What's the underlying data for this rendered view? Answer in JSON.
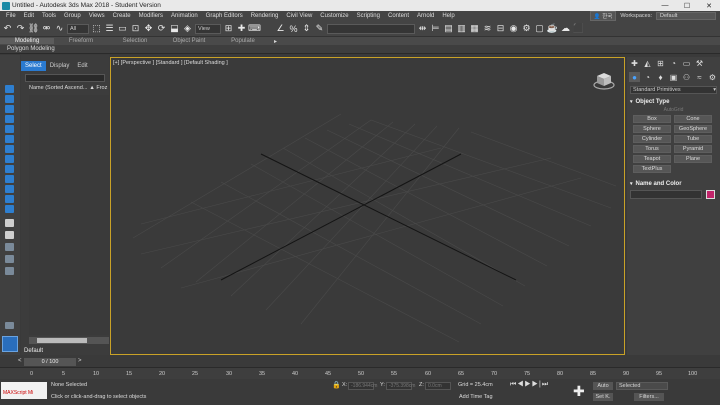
{
  "window": {
    "title": "Untitled - Autodesk 3ds Max 2018 - Student Version",
    "minimize": "—",
    "maximize": "☐",
    "close": "✕"
  },
  "menu": {
    "items": [
      "File",
      "Edit",
      "Tools",
      "Group",
      "Views",
      "Create",
      "Modifiers",
      "Animation",
      "Graph Editors",
      "Rendering",
      "Civil View",
      "Customize",
      "Scripting",
      "Content",
      "Arnold",
      "Help"
    ],
    "user": "👤 한국",
    "workspaces_label": "Workspaces:",
    "workspace": "Default"
  },
  "toolbar": {
    "selection_filter": "All",
    "ref_coord": "View"
  },
  "ribbon": {
    "tabs": [
      "Modeling",
      "Freeform",
      "Selection",
      "Object Paint",
      "Populate"
    ],
    "subtitle": "Polygon Modeling"
  },
  "scene_explorer": {
    "tabs": [
      "Select",
      "Display",
      "Edit"
    ],
    "column_name": "Name (Sorted Ascend...",
    "column_frozen": "▲ Froz"
  },
  "layer": {
    "name": "Default"
  },
  "viewport": {
    "label": "[+] [Perspective ] [Standard ] [Default Shading ]"
  },
  "command_panel": {
    "category": "Standard Primitives",
    "object_type_title": "Object Type",
    "autogrid": "AutoGrid",
    "primitives": [
      "Box",
      "Cone",
      "Sphere",
      "GeoSphere",
      "Cylinder",
      "Tube",
      "Torus",
      "Pyramid",
      "Teapot",
      "Plane",
      "TextPlus"
    ],
    "name_color_title": "Name and Color",
    "color": "#c2256b"
  },
  "timeline": {
    "frame": "0 / 100",
    "ticks": [
      "0",
      "5",
      "10",
      "15",
      "20",
      "25",
      "30",
      "35",
      "40",
      "45",
      "50",
      "55",
      "60",
      "65",
      "70",
      "75",
      "80",
      "85",
      "90",
      "95",
      "100"
    ]
  },
  "status": {
    "maxscript": "MAXScript Mi",
    "selection": "None Selected",
    "prompt": "Click or click-and-drag to select objects",
    "x_label": "X:",
    "y_label": "Y:",
    "z_label": "Z:",
    "x_value": "-186.944cm",
    "y_value": "-375.398cm",
    "z_value": "0.0cm",
    "grid": "Grid = 25.4cm",
    "add_time_tag": "Add Time Tag",
    "auto": "Auto",
    "set_k": "Set K.",
    "selected": "Selected",
    "filters": "Filters..."
  }
}
